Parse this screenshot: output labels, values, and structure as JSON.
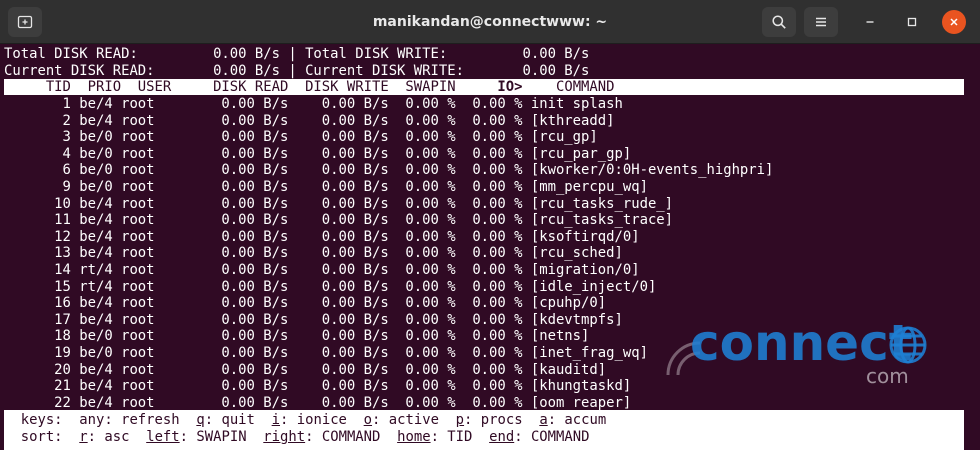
{
  "window": {
    "title": "manikandan@connectwww: ~",
    "icons": {
      "new_tab": "new-tab-icon",
      "search": "search-icon",
      "menu": "hamburger-menu-icon",
      "minimize": "minimize-icon",
      "maximize": "maximize-icon",
      "close": "close-icon"
    },
    "colors": {
      "terminal_bg": "#300a24",
      "close_button": "#e95420",
      "titlebar": "#303030"
    }
  },
  "summary": {
    "total_read": "Total DISK READ:         0.00 B/s | Total DISK WRITE:         0.00 B/s",
    "current_read": "Current DISK READ:       0.00 B/s | Current DISK WRITE:       0.00 B/s"
  },
  "table": {
    "header": "     TID  PRIO  USER     DISK READ  DISK WRITE  SWAPIN     ",
    "header_sorted": "IO>",
    "header_tail": "    COMMAND",
    "rows": [
      "       1 be/4 root        0.00 B/s    0.00 B/s  0.00 %  0.00 % init splash",
      "       2 be/4 root        0.00 B/s    0.00 B/s  0.00 %  0.00 % [kthreadd]",
      "       3 be/0 root        0.00 B/s    0.00 B/s  0.00 %  0.00 % [rcu_gp]",
      "       4 be/0 root        0.00 B/s    0.00 B/s  0.00 %  0.00 % [rcu_par_gp]",
      "       6 be/0 root        0.00 B/s    0.00 B/s  0.00 %  0.00 % [kworker/0:0H-events_highpri]",
      "       9 be/0 root        0.00 B/s    0.00 B/s  0.00 %  0.00 % [mm_percpu_wq]",
      "      10 be/4 root        0.00 B/s    0.00 B/s  0.00 %  0.00 % [rcu_tasks_rude_]",
      "      11 be/4 root        0.00 B/s    0.00 B/s  0.00 %  0.00 % [rcu_tasks_trace]",
      "      12 be/4 root        0.00 B/s    0.00 B/s  0.00 %  0.00 % [ksoftirqd/0]",
      "      13 be/4 root        0.00 B/s    0.00 B/s  0.00 %  0.00 % [rcu_sched]",
      "      14 rt/4 root        0.00 B/s    0.00 B/s  0.00 %  0.00 % [migration/0]",
      "      15 rt/4 root        0.00 B/s    0.00 B/s  0.00 %  0.00 % [idle_inject/0]",
      "      16 be/4 root        0.00 B/s    0.00 B/s  0.00 %  0.00 % [cpuhp/0]",
      "      17 be/4 root        0.00 B/s    0.00 B/s  0.00 %  0.00 % [kdevtmpfs]",
      "      18 be/0 root        0.00 B/s    0.00 B/s  0.00 %  0.00 % [netns]",
      "      19 be/0 root        0.00 B/s    0.00 B/s  0.00 %  0.00 % [inet_frag_wq]",
      "      20 be/4 root        0.00 B/s    0.00 B/s  0.00 %  0.00 % [kauditd]",
      "      21 be/4 root        0.00 B/s    0.00 B/s  0.00 %  0.00 % [khungtaskd]",
      "      22 be/4 root        0.00 B/s    0.00 B/s  0.00 %  0.00 % [oom_reaper]"
    ]
  },
  "footer": {
    "keys": [
      {
        "text": "  keys:  any: refresh  ",
        "u": false
      },
      {
        "text": "q",
        "u": true
      },
      {
        "text": ": quit  ",
        "u": false
      },
      {
        "text": "i",
        "u": true
      },
      {
        "text": ": ionice  ",
        "u": false
      },
      {
        "text": "o",
        "u": true
      },
      {
        "text": ": active  ",
        "u": false
      },
      {
        "text": "p",
        "u": true
      },
      {
        "text": ": procs  ",
        "u": false
      },
      {
        "text": "a",
        "u": true
      },
      {
        "text": ": accum",
        "u": false
      }
    ],
    "sort": [
      {
        "text": "  sort:  ",
        "u": false
      },
      {
        "text": "r",
        "u": true
      },
      {
        "text": ": asc  ",
        "u": false
      },
      {
        "text": "left",
        "u": true
      },
      {
        "text": ": SWAPIN  ",
        "u": false
      },
      {
        "text": "right",
        "u": true
      },
      {
        "text": ": COMMAND  ",
        "u": false
      },
      {
        "text": "home",
        "u": true
      },
      {
        "text": ": TID  ",
        "u": false
      },
      {
        "text": "end",
        "u": true
      },
      {
        "text": ": COMMAND",
        "u": false
      }
    ]
  },
  "watermark": {
    "brand": "connect",
    "suffix": "com",
    "brand_color": "#1e7fd4"
  }
}
